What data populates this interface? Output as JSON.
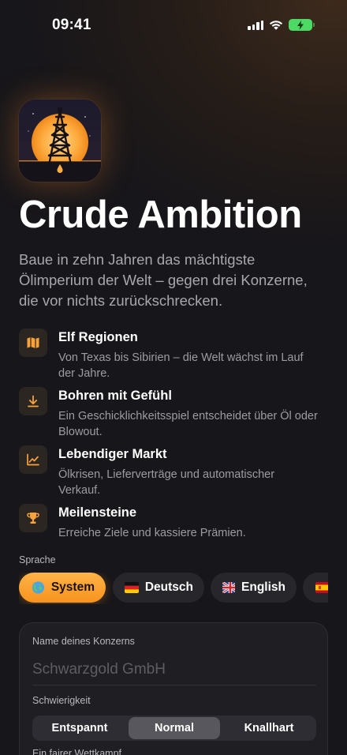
{
  "status_bar": {
    "time": "09:41"
  },
  "app": {
    "title": "Crude Ambition",
    "subtitle": "Baue in zehn Jahren das mächtigste Ölimperium der Welt – gegen drei Konzerne, die vor nichts zurückschrecken."
  },
  "features": [
    {
      "icon": "map-icon",
      "title": "Elf Regionen",
      "description": "Von Texas bis Sibirien – die Welt wächst im Lauf der Jahre."
    },
    {
      "icon": "download-arrow-icon",
      "title": "Bohren mit Gefühl",
      "description": "Ein Geschicklichkeitsspiel entscheidet über Öl oder Blowout."
    },
    {
      "icon": "chart-line-icon",
      "title": "Lebendiger Markt",
      "description": "Ölkrisen, Lieferverträge und automatischer Verkauf."
    },
    {
      "icon": "trophy-icon",
      "title": "Meilensteine",
      "description": "Erreiche Ziele und kassiere Prämien."
    }
  ],
  "language": {
    "label": "Sprache",
    "options": [
      {
        "label": "System",
        "icon": "globe-icon",
        "selected": true
      },
      {
        "label": "Deutsch",
        "icon": "flag-germany-icon",
        "selected": false
      },
      {
        "label": "English",
        "icon": "flag-uk-icon",
        "selected": false
      },
      {
        "label": "",
        "icon": "flag-spain-icon",
        "selected": false
      }
    ]
  },
  "form": {
    "company_label": "Name deines Konzerns",
    "company_value": "",
    "company_placeholder": "Schwarzgold GmbH",
    "difficulty_label": "Schwierigkeit",
    "difficulty_options": [
      "Entspannt",
      "Normal",
      "Knallhart"
    ],
    "difficulty_selected": "Normal",
    "difficulty_hint": "Ein fairer Wettkampf"
  },
  "colors": {
    "accent": "#f7931e",
    "accent_light": "#ffb347",
    "background": "#17161a",
    "card": "#1f1e23",
    "battery": "#4cd964"
  }
}
